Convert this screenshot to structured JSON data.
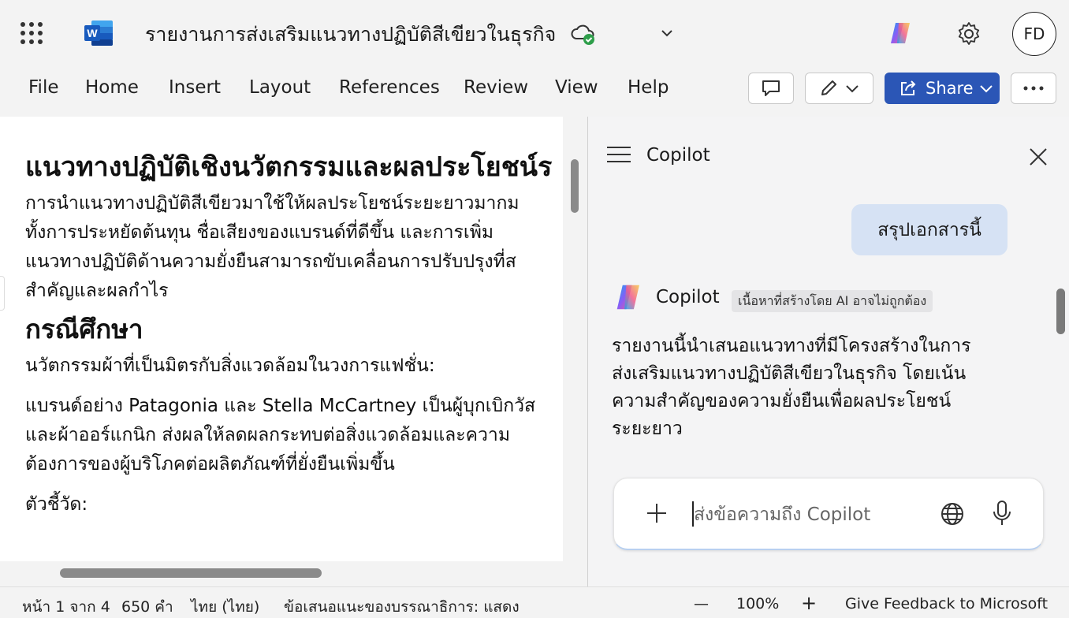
{
  "app": {
    "document_title": "รายงานการส่งเสริมแนวทางปฏิบัติสีเขียวในธุรกิจ",
    "avatar_initials": "FD"
  },
  "ribbon": {
    "tabs": [
      "File",
      "Home",
      "Insert",
      "Layout",
      "References",
      "Review",
      "View",
      "Help"
    ],
    "share_label": "Share"
  },
  "document": {
    "heading1": "แนวทางปฏิบัติเชิงนวัตกรรมและผลประโยชน์ร",
    "para1": [
      "การนำแนวทางปฏิบัติสีเขียวมาใช้ให้ผลประโยชน์ระยะยาวมากม",
      "ทั้งการประหยัดต้นทุน ชื่อเสียงของแบรนด์ที่ดีขึ้น และการเพิ่ม",
      "แนวทางปฏิบัติด้านความยั่งยืนสามารถขับเคลื่อนการปรับปรุงที่ส",
      "สำคัญและผลกำไร"
    ],
    "heading2": "กรณีศึกษา",
    "para2": "นวัตกรรมผ้าที่เป็นมิตรกับสิ่งแวดล้อมในวงการแฟชั่น:",
    "para3": [
      "แบรนด์อย่าง Patagonia และ Stella McCartney เป็นผู้บุกเบิกวัส",
      "และผ้าออร์แกนิก ส่งผลให้ลดผลกระทบต่อสิ่งแวดล้อมและความ",
      "ต้องการของผู้บริโภคต่อผลิตภัณฑ์ที่ยั่งยืนเพิ่มขึ้น"
    ],
    "para4": "ตัวชี้วัด:"
  },
  "copilot": {
    "pane_title": "Copilot",
    "user_message": "สรุปเอกสารนี้",
    "assistant_name": "Copilot",
    "ai_disclaimer": "เนื้อหาที่สร้างโดย AI อาจไม่ถูกต้อง",
    "answer_lines": [
      "รายงานนี้นำเสนอแนวทางที่มีโครงสร้างในการ",
      "ส่งเสริมแนวทางปฏิบัติสีเขียวในธุรกิจ โดยเน้น",
      "ความสำคัญของความยั่งยืนเพื่อผลประโยชน์",
      "ระยะยาว"
    ],
    "input_placeholder": "ส่งข้อความถึง Copilot"
  },
  "statusbar": {
    "page_info": "หน้า 1 จาก 4",
    "word_count": "650 คำ",
    "language": "ไทย (ไทย)",
    "editor_suggestions": "ข้อเสนอแนะของบรรณาธิการ: แสดง",
    "zoom_minus": "—",
    "zoom": "100%",
    "zoom_plus": "+",
    "feedback": "Give Feedback to Microsoft"
  },
  "colors": {
    "share_blue": "#2b56b6",
    "user_bubble": "#d6e2f4",
    "word_blue": "#185abd",
    "cloud_green": "#2e9e4a"
  }
}
